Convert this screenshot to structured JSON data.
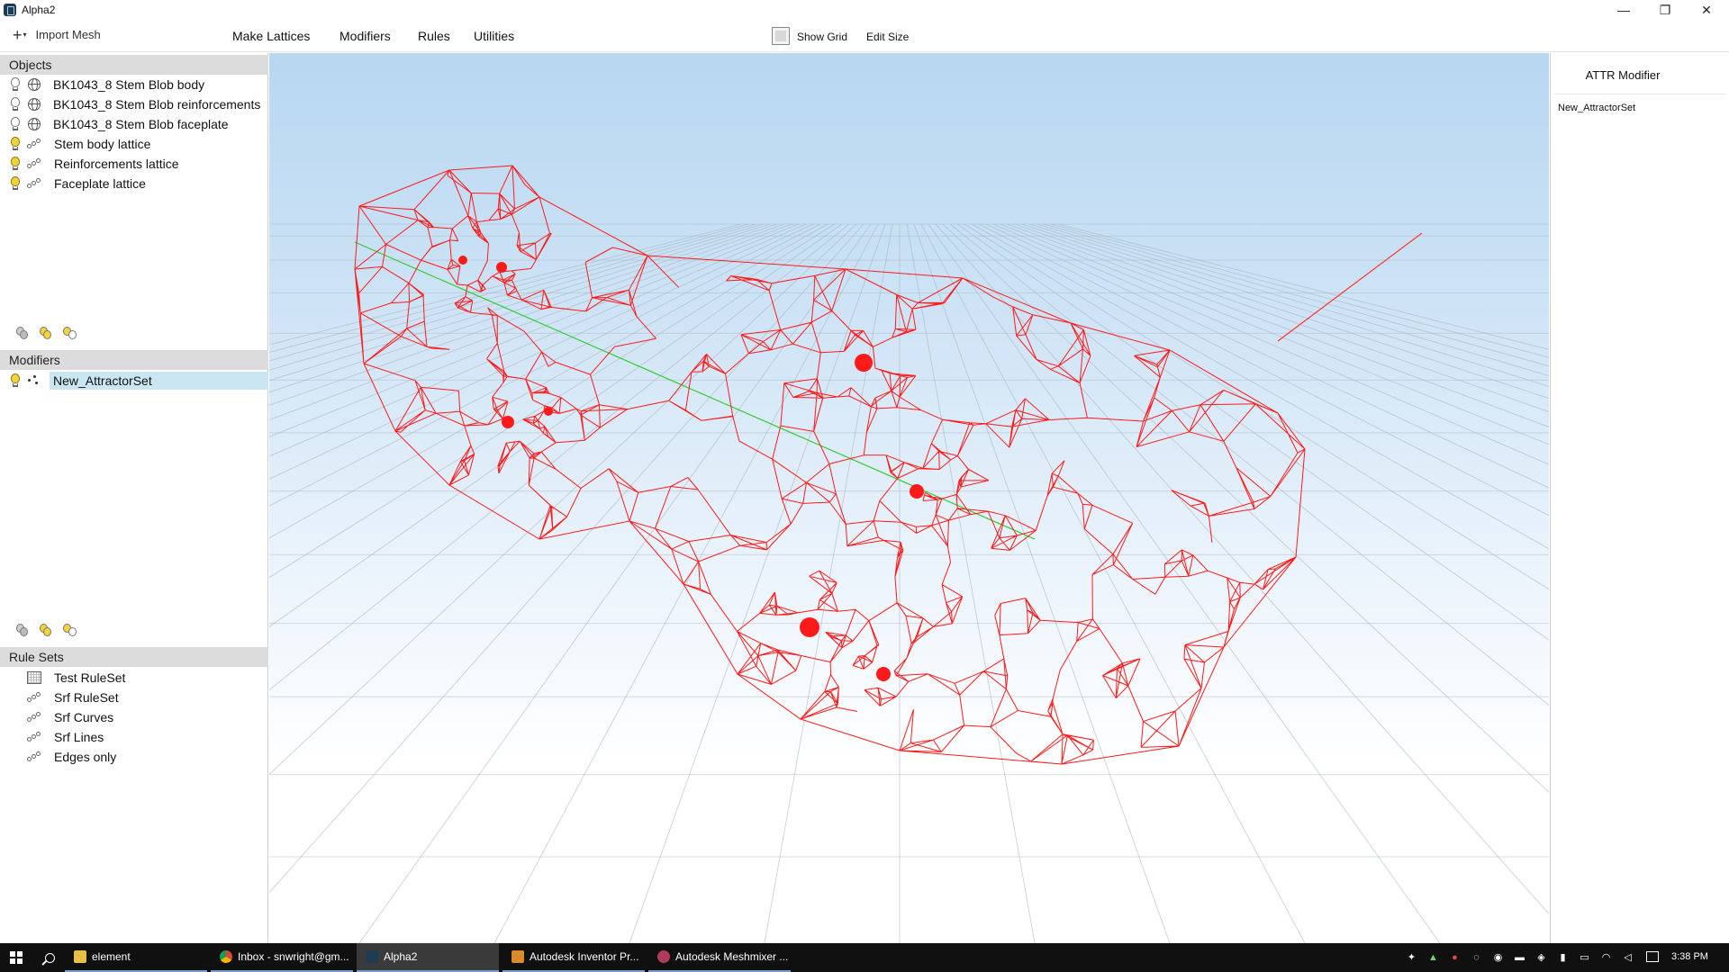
{
  "window": {
    "title": "Alpha2",
    "minimize": "—",
    "restore": "❐",
    "close": "✕"
  },
  "toolbar": {
    "import_label": "Import Mesh",
    "menus": [
      "Make Lattices",
      "Modifiers",
      "Rules",
      "Utilities"
    ],
    "show_grid_label": "Show Grid",
    "edit_size_label": "Edit Size"
  },
  "objects": {
    "header": "Objects",
    "items": [
      {
        "label": "BK1043_8 Stem Blob body",
        "visible": false,
        "kind": "mesh"
      },
      {
        "label": "BK1043_8 Stem Blob reinforcements",
        "visible": false,
        "kind": "mesh"
      },
      {
        "label": "BK1043_8 Stem Blob faceplate",
        "visible": false,
        "kind": "mesh"
      },
      {
        "label": "Stem body lattice",
        "visible": true,
        "kind": "lattice"
      },
      {
        "label": "Reinforcements lattice",
        "visible": true,
        "kind": "lattice"
      },
      {
        "label": "Faceplate lattice",
        "visible": true,
        "kind": "lattice"
      }
    ]
  },
  "modifiers": {
    "header": "Modifiers",
    "items": [
      {
        "label": "New_AttractorSet",
        "visible": true,
        "selected": true
      }
    ]
  },
  "rule_sets": {
    "header": "Rule Sets",
    "items": [
      "Test RuleSet",
      "Srf RuleSet",
      "Srf Curves",
      "Srf Lines",
      "Edges only"
    ]
  },
  "attr_panel": {
    "title": "ATTR Modifier",
    "item": "New_AttractorSet"
  },
  "viewport": {
    "lattice_color": "#ff1a1a",
    "axis_x_color": "#ff3333",
    "axis_y_color": "#33cc33"
  },
  "taskbar": {
    "apps": [
      {
        "label": "element",
        "active": false
      },
      {
        "label": "Inbox - snwright@gm...",
        "active": false
      },
      {
        "label": "Alpha2",
        "active": true
      },
      {
        "label": "Autodesk Inventor Pr...",
        "active": false
      },
      {
        "label": "Autodesk Meshmixer ...",
        "active": false
      }
    ],
    "clock": "3:38 PM"
  }
}
